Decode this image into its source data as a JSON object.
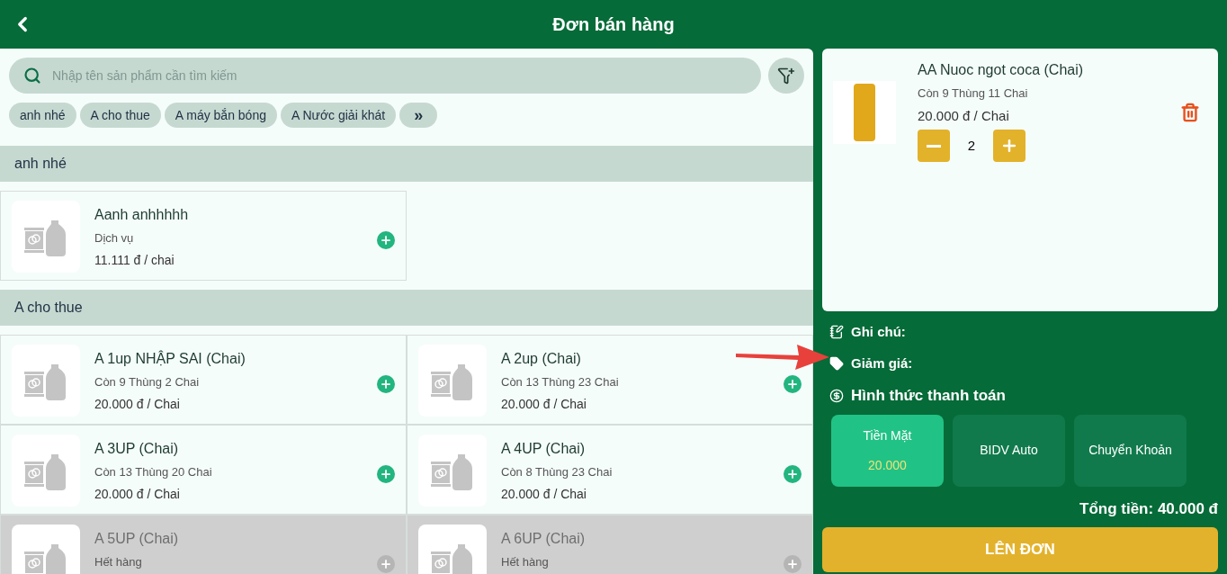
{
  "header": {
    "title": "Đơn bán hàng"
  },
  "search": {
    "placeholder": "Nhập tên sản phẩm cần tìm kiếm"
  },
  "category_chips": [
    "anh nhé",
    "A cho thue",
    "A máy bắn bóng",
    "A Nước giải khát"
  ],
  "more_chip": "»",
  "sections": [
    {
      "title": "anh nhé",
      "products": [
        {
          "name": "Aanh anhhhhh",
          "stock": "Dịch vụ",
          "price": "11.111 đ / chai",
          "out_of_stock": false
        }
      ]
    },
    {
      "title": "A cho thue",
      "products": [
        {
          "name": "A 1up NHẬP SAI (Chai)",
          "stock": "Còn 9 Thùng 2 Chai",
          "price": "20.000 đ / Chai",
          "out_of_stock": false
        },
        {
          "name": "A 2up (Chai)",
          "stock": "Còn 13 Thùng 23 Chai",
          "price": "20.000 đ / Chai",
          "out_of_stock": false
        },
        {
          "name": "A 3UP (Chai)",
          "stock": "Còn 13 Thùng 20 Chai",
          "price": "20.000 đ / Chai",
          "out_of_stock": false
        },
        {
          "name": "A 4UP (Chai)",
          "stock": "Còn 8 Thùng 23 Chai",
          "price": "20.000 đ / Chai",
          "out_of_stock": false
        },
        {
          "name": "A 5UP (Chai)",
          "stock": "Hết hàng",
          "out_of_stock": true
        },
        {
          "name": "A 6UP (Chai)",
          "stock": "Hết hàng",
          "out_of_stock": true
        }
      ]
    }
  ],
  "cart": [
    {
      "name": "AA Nuoc ngot coca (Chai)",
      "stock": "Còn 9 Thùng 11 Chai",
      "price": "20.000 đ / Chai",
      "quantity": "2"
    }
  ],
  "order": {
    "note_label": "Ghi chú:",
    "discount_label": "Giảm giá:",
    "payment_label": "Hình thức thanh toán",
    "payment_methods": [
      {
        "label": "Tiền Mặt",
        "amount": "20.000",
        "selected": true
      },
      {
        "label": "BIDV Auto",
        "selected": false
      },
      {
        "label": "Chuyển Khoản",
        "selected": false
      }
    ],
    "total": "Tổng tiền: 40.000 đ",
    "submit": "LÊN ĐƠN"
  }
}
